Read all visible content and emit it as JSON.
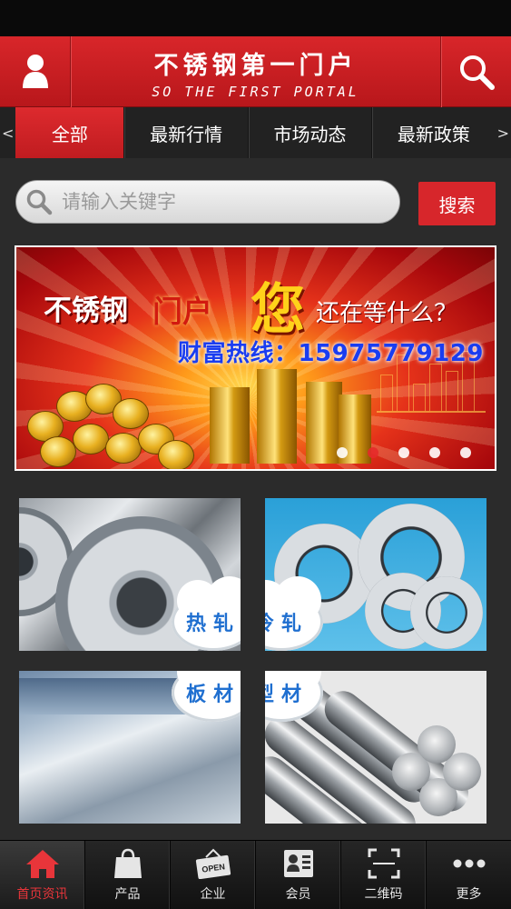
{
  "header": {
    "title": "不锈钢第一门户",
    "subtitle": "SO THE FIRST PORTAL",
    "user_icon": "user-icon",
    "search_icon": "search-icon"
  },
  "tabs": {
    "prev_arrow": "<",
    "next_arrow": ">",
    "items": [
      {
        "label": "全部",
        "active": true
      },
      {
        "label": "最新行情",
        "active": false
      },
      {
        "label": "市场动态",
        "active": false
      },
      {
        "label": "最新政策",
        "active": false
      }
    ]
  },
  "search": {
    "placeholder": "请输入关键字",
    "button_label": "搜索"
  },
  "banner": {
    "line1a": "不锈钢",
    "line1b": "门户",
    "big": "您",
    "line1c": "还在等什么？",
    "hotline": "财富热线：15975779129",
    "slide_count": 5,
    "active_slide": 2
  },
  "categories": [
    {
      "label": "热轧"
    },
    {
      "label": "冷轧"
    },
    {
      "label": "板材"
    },
    {
      "label": "型材"
    }
  ],
  "tabbar": {
    "items": [
      {
        "label": "首页资讯",
        "icon": "home-icon",
        "active": true
      },
      {
        "label": "产品",
        "icon": "shopping-bag-icon",
        "active": false
      },
      {
        "label": "企业",
        "icon": "open-sign-icon",
        "active": false
      },
      {
        "label": "会员",
        "icon": "member-card-icon",
        "active": false
      },
      {
        "label": "二维码",
        "icon": "qr-scan-icon",
        "active": false
      },
      {
        "label": "更多",
        "icon": "more-icon",
        "active": false
      }
    ]
  },
  "colors": {
    "accent": "#d7262b",
    "active_tab_text": "#e8353a",
    "hotline": "#1a3df0",
    "category_text": "#1f6fd0"
  }
}
